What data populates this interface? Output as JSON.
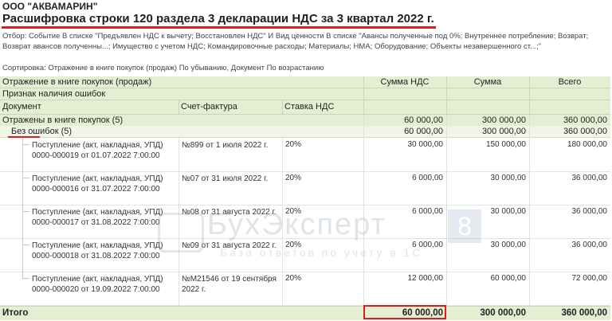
{
  "org": "ООО \"АКВАМАРИН\"",
  "title": "Расшифровка строки 120 раздела 3 декларации НДС за 3 квартал 2022 г.",
  "filter": "Отбор: Событие В списке \"Предъявлен НДС к вычету; Восстановлен НДС\" И Вид ценности В списке \"Авансы полученные под 0%; Внутреннее потребление; Возврат; Возврат авансов полученны...; Имущество с учетом НДС; Командировочные расходы; Материалы; НМА; Оборудование; Объекты незавершенного ст...;\"",
  "sort": "Сортировка: Отражение в книге покупок (продаж) По убыванию, Документ По возрастанию",
  "headers": {
    "h1": "Отражение в книге покупок (продаж)",
    "h2": "Признак наличия ошибок",
    "doc": "Документ",
    "invoice": "Счет-фактура",
    "rate": "Ставка НДС",
    "vat": "Сумма НДС",
    "sum": "Сумма",
    "total": "Всего"
  },
  "group1": {
    "label": "Отражены в книге покупок (5)",
    "vat": "60 000,00",
    "sum": "300 000,00",
    "total": "360 000,00"
  },
  "group2": {
    "label": "Без ошибок (5)",
    "vat": "60 000,00",
    "sum": "300 000,00",
    "total": "360 000,00"
  },
  "rows": [
    {
      "doc": "Поступление (акт, накладная, УПД) 0000-000019 от 01.07.2022 7:00:00",
      "inv": "№899 от 1 июля 2022 г.",
      "rate": "20%",
      "vat": "30 000,00",
      "sum": "150 000,00",
      "total": "180 000,00"
    },
    {
      "doc": "Поступление (акт, накладная, УПД) 0000-000016 от 31.07.2022 7:00:00",
      "inv": "№07 от 31 июля 2022 г.",
      "rate": "20%",
      "vat": "6 000,00",
      "sum": "30 000,00",
      "total": "36 000,00"
    },
    {
      "doc": "Поступление (акт, накладная, УПД) 0000-000017 от 31.08.2022 7:00:00",
      "inv": "№08 от 31 августа 2022 г.",
      "rate": "20%",
      "vat": "6 000,00",
      "sum": "30 000,00",
      "total": "36 000,00"
    },
    {
      "doc": "Поступление (акт, накладная, УПД) 0000-000018 от 31.08.2022 7:00:00",
      "inv": "№09 от 31 августа 2022 г.",
      "rate": "20%",
      "vat": "6 000,00",
      "sum": "30 000,00",
      "total": "36 000,00"
    },
    {
      "doc": "Поступление (акт, накладная, УПД) 0000-000020 от 19.09.2022 7:00:00",
      "inv": "№М21546 от 19 сентября 2022 г.",
      "rate": "20%",
      "vat": "12 000,00",
      "sum": "60 000,00",
      "total": "72 000,00"
    }
  ],
  "footer": {
    "label": "Итого",
    "vat": "60 000,00",
    "sum": "300 000,00",
    "total": "360 000,00"
  },
  "watermark": {
    "brand": "БухЭксперт",
    "digit": "8",
    "tagline": "База ответов по учету в 1С"
  },
  "colors": {
    "header_bg": "#e5eed3",
    "highlight": "#e11b1b"
  }
}
